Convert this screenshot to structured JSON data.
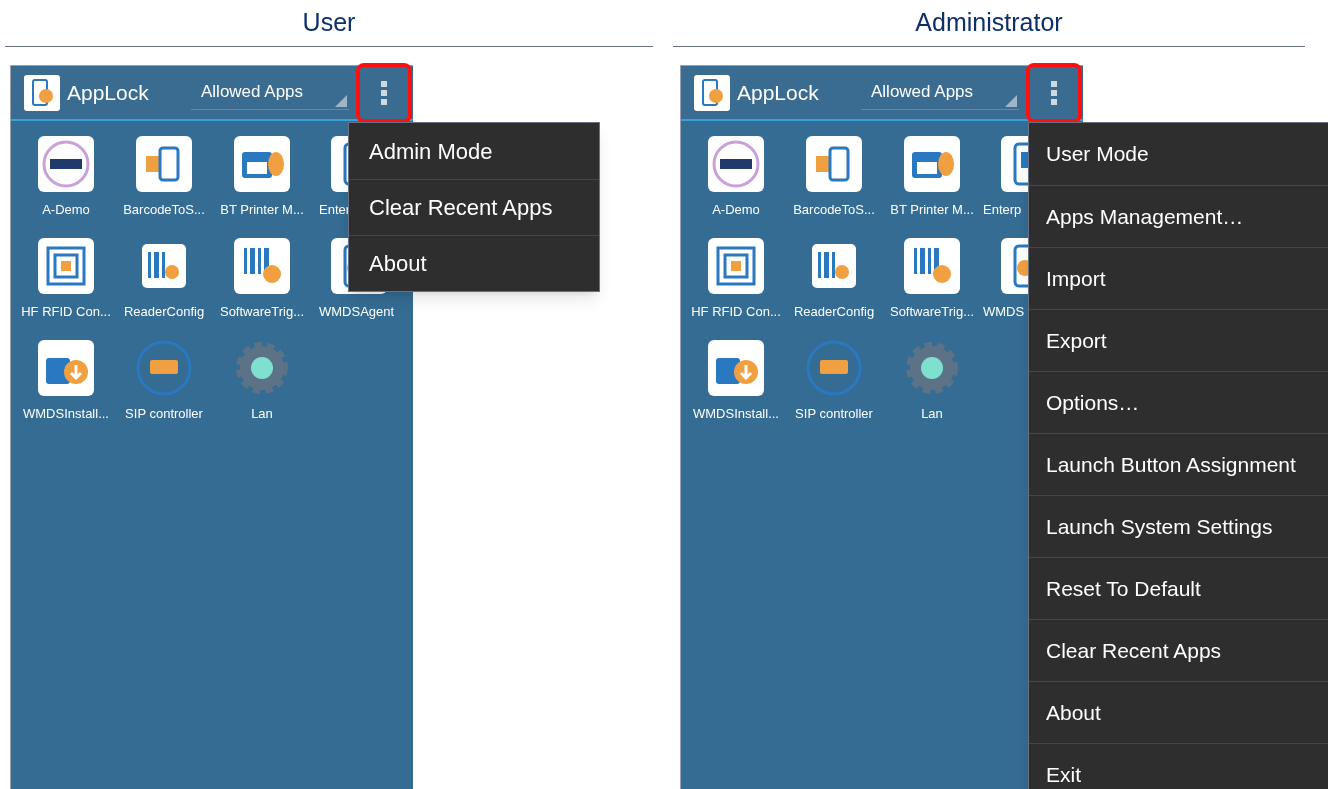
{
  "panels": [
    {
      "heading": "User",
      "app_bar": {
        "title": "AppLock",
        "spinner": "Allowed Apps",
        "overflow_highlighted": true
      },
      "apps": [
        {
          "label": "A-Demo"
        },
        {
          "label": "BarcodeToS..."
        },
        {
          "label": "BT Printer M..."
        },
        {
          "label": "Enter"
        },
        {
          "label": "HF RFID Con..."
        },
        {
          "label": "ReaderConfig"
        },
        {
          "label": "SoftwareTrig..."
        },
        {
          "label": "WMDSAgent"
        },
        {
          "label": "WMDSInstall..."
        },
        {
          "label": "SIP controller"
        },
        {
          "label": "Lan"
        }
      ],
      "menu": {
        "items": [
          "Admin Mode",
          "Clear Recent Apps",
          "About"
        ]
      }
    },
    {
      "heading": "Administrator",
      "app_bar": {
        "title": "AppLock",
        "spinner": "Allowed Apps",
        "overflow_highlighted": true
      },
      "apps": [
        {
          "label": "A-Demo"
        },
        {
          "label": "BarcodeToS..."
        },
        {
          "label": "BT Printer M..."
        },
        {
          "label": "Enterp"
        },
        {
          "label": "HF RFID Con..."
        },
        {
          "label": "ReaderConfig"
        },
        {
          "label": "SoftwareTrig..."
        },
        {
          "label": "WMDS"
        },
        {
          "label": "WMDSInstall..."
        },
        {
          "label": "SIP controller"
        },
        {
          "label": "Lan"
        }
      ],
      "menu": {
        "items": [
          "User Mode",
          "Apps Management…",
          "Import",
          "Export",
          "Options…",
          "Launch Button Assignment",
          "Launch System Settings",
          "Reset To Default",
          "Clear Recent Apps",
          "About",
          "Exit"
        ]
      }
    }
  ]
}
